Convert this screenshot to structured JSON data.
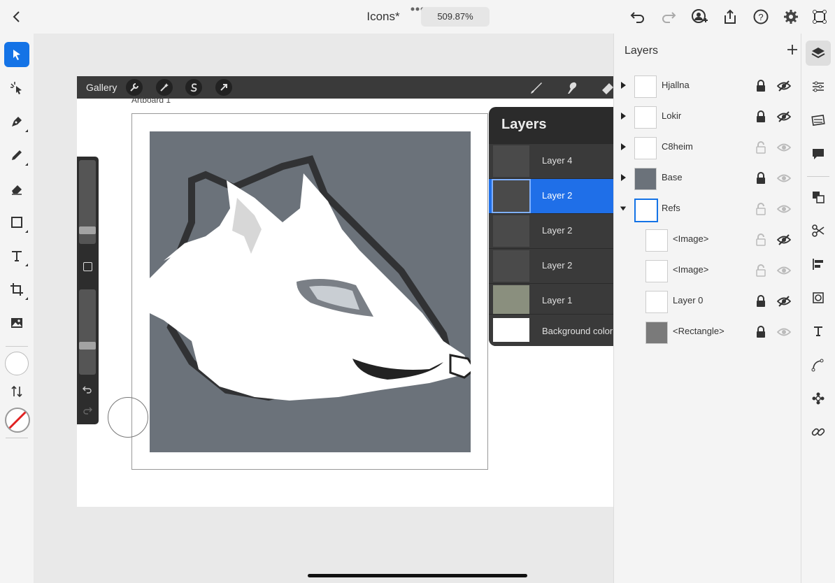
{
  "header": {
    "title": "Icons*",
    "zoom": "509.87%"
  },
  "screenshot": {
    "gallery_label": "Gallery",
    "artboard_label": "Artboard 1",
    "layers_popup": {
      "title": "Layers",
      "rows": [
        {
          "label": "Layer 4",
          "selected": false
        },
        {
          "label": "Layer 2",
          "selected": true
        },
        {
          "label": "Layer 2",
          "selected": false
        },
        {
          "label": "Layer 2",
          "selected": false
        },
        {
          "label": "Layer 1",
          "selected": false
        },
        {
          "label": "Background color",
          "selected": false
        }
      ]
    }
  },
  "layers_panel": {
    "title": "Layers",
    "items": [
      {
        "label": "Hjallna",
        "expanded": false,
        "locked": true,
        "hidden": true
      },
      {
        "label": "Lokir",
        "expanded": false,
        "locked": true,
        "hidden": true
      },
      {
        "label": "C8heim",
        "expanded": false,
        "locked": false,
        "hidden": false
      },
      {
        "label": "Base",
        "expanded": false,
        "locked": true,
        "hidden": false
      },
      {
        "label": "Refs",
        "expanded": true,
        "locked": false,
        "hidden": false
      },
      {
        "label": "<Image>",
        "expanded": false,
        "locked": false,
        "hidden": true
      },
      {
        "label": "<Image>",
        "expanded": false,
        "locked": false,
        "hidden": false
      },
      {
        "label": "Layer 0",
        "expanded": false,
        "locked": true,
        "hidden": true
      },
      {
        "label": "<Rectangle>",
        "expanded": false,
        "locked": true,
        "hidden": false
      }
    ]
  },
  "colors": {
    "accent": "#1473e6",
    "art_background": "#6b727a",
    "base_swatch": "#6b727a",
    "rect_swatch": "#7a7a7a"
  }
}
